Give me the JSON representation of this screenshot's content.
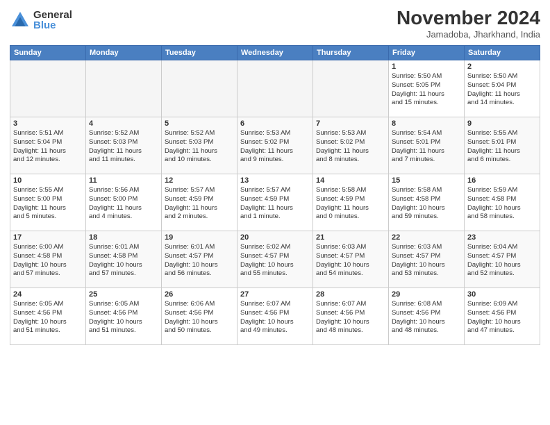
{
  "logo": {
    "general": "General",
    "blue": "Blue"
  },
  "title": "November 2024",
  "location": "Jamadoba, Jharkhand, India",
  "weekdays": [
    "Sunday",
    "Monday",
    "Tuesday",
    "Wednesday",
    "Thursday",
    "Friday",
    "Saturday"
  ],
  "weeks": [
    [
      {
        "day": "",
        "info": ""
      },
      {
        "day": "",
        "info": ""
      },
      {
        "day": "",
        "info": ""
      },
      {
        "day": "",
        "info": ""
      },
      {
        "day": "",
        "info": ""
      },
      {
        "day": "1",
        "info": "Sunrise: 5:50 AM\nSunset: 5:05 PM\nDaylight: 11 hours\nand 15 minutes."
      },
      {
        "day": "2",
        "info": "Sunrise: 5:50 AM\nSunset: 5:04 PM\nDaylight: 11 hours\nand 14 minutes."
      }
    ],
    [
      {
        "day": "3",
        "info": "Sunrise: 5:51 AM\nSunset: 5:04 PM\nDaylight: 11 hours\nand 12 minutes."
      },
      {
        "day": "4",
        "info": "Sunrise: 5:52 AM\nSunset: 5:03 PM\nDaylight: 11 hours\nand 11 minutes."
      },
      {
        "day": "5",
        "info": "Sunrise: 5:52 AM\nSunset: 5:03 PM\nDaylight: 11 hours\nand 10 minutes."
      },
      {
        "day": "6",
        "info": "Sunrise: 5:53 AM\nSunset: 5:02 PM\nDaylight: 11 hours\nand 9 minutes."
      },
      {
        "day": "7",
        "info": "Sunrise: 5:53 AM\nSunset: 5:02 PM\nDaylight: 11 hours\nand 8 minutes."
      },
      {
        "day": "8",
        "info": "Sunrise: 5:54 AM\nSunset: 5:01 PM\nDaylight: 11 hours\nand 7 minutes."
      },
      {
        "day": "9",
        "info": "Sunrise: 5:55 AM\nSunset: 5:01 PM\nDaylight: 11 hours\nand 6 minutes."
      }
    ],
    [
      {
        "day": "10",
        "info": "Sunrise: 5:55 AM\nSunset: 5:00 PM\nDaylight: 11 hours\nand 5 minutes."
      },
      {
        "day": "11",
        "info": "Sunrise: 5:56 AM\nSunset: 5:00 PM\nDaylight: 11 hours\nand 4 minutes."
      },
      {
        "day": "12",
        "info": "Sunrise: 5:57 AM\nSunset: 4:59 PM\nDaylight: 11 hours\nand 2 minutes."
      },
      {
        "day": "13",
        "info": "Sunrise: 5:57 AM\nSunset: 4:59 PM\nDaylight: 11 hours\nand 1 minute."
      },
      {
        "day": "14",
        "info": "Sunrise: 5:58 AM\nSunset: 4:59 PM\nDaylight: 11 hours\nand 0 minutes."
      },
      {
        "day": "15",
        "info": "Sunrise: 5:58 AM\nSunset: 4:58 PM\nDaylight: 10 hours\nand 59 minutes."
      },
      {
        "day": "16",
        "info": "Sunrise: 5:59 AM\nSunset: 4:58 PM\nDaylight: 10 hours\nand 58 minutes."
      }
    ],
    [
      {
        "day": "17",
        "info": "Sunrise: 6:00 AM\nSunset: 4:58 PM\nDaylight: 10 hours\nand 57 minutes."
      },
      {
        "day": "18",
        "info": "Sunrise: 6:01 AM\nSunset: 4:58 PM\nDaylight: 10 hours\nand 57 minutes."
      },
      {
        "day": "19",
        "info": "Sunrise: 6:01 AM\nSunset: 4:57 PM\nDaylight: 10 hours\nand 56 minutes."
      },
      {
        "day": "20",
        "info": "Sunrise: 6:02 AM\nSunset: 4:57 PM\nDaylight: 10 hours\nand 55 minutes."
      },
      {
        "day": "21",
        "info": "Sunrise: 6:03 AM\nSunset: 4:57 PM\nDaylight: 10 hours\nand 54 minutes."
      },
      {
        "day": "22",
        "info": "Sunrise: 6:03 AM\nSunset: 4:57 PM\nDaylight: 10 hours\nand 53 minutes."
      },
      {
        "day": "23",
        "info": "Sunrise: 6:04 AM\nSunset: 4:57 PM\nDaylight: 10 hours\nand 52 minutes."
      }
    ],
    [
      {
        "day": "24",
        "info": "Sunrise: 6:05 AM\nSunset: 4:56 PM\nDaylight: 10 hours\nand 51 minutes."
      },
      {
        "day": "25",
        "info": "Sunrise: 6:05 AM\nSunset: 4:56 PM\nDaylight: 10 hours\nand 51 minutes."
      },
      {
        "day": "26",
        "info": "Sunrise: 6:06 AM\nSunset: 4:56 PM\nDaylight: 10 hours\nand 50 minutes."
      },
      {
        "day": "27",
        "info": "Sunrise: 6:07 AM\nSunset: 4:56 PM\nDaylight: 10 hours\nand 49 minutes."
      },
      {
        "day": "28",
        "info": "Sunrise: 6:07 AM\nSunset: 4:56 PM\nDaylight: 10 hours\nand 48 minutes."
      },
      {
        "day": "29",
        "info": "Sunrise: 6:08 AM\nSunset: 4:56 PM\nDaylight: 10 hours\nand 48 minutes."
      },
      {
        "day": "30",
        "info": "Sunrise: 6:09 AM\nSunset: 4:56 PM\nDaylight: 10 hours\nand 47 minutes."
      }
    ]
  ]
}
